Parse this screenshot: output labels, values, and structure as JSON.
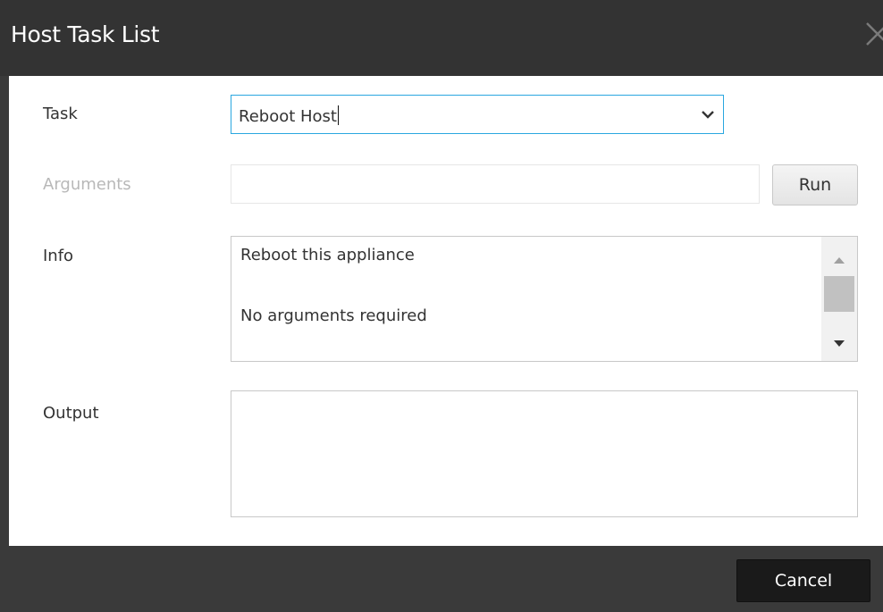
{
  "window": {
    "title": "Host Task List",
    "close_icon": "close-icon"
  },
  "form": {
    "task": {
      "label": "Task",
      "value": "Reboot Host",
      "icon": "chevron-down-icon"
    },
    "arguments": {
      "label": "Arguments",
      "value": "",
      "placeholder": "",
      "enabled": false
    },
    "run_label": "Run",
    "info": {
      "label": "Info",
      "lines": [
        "Reboot this appliance",
        "No arguments required"
      ]
    },
    "output": {
      "label": "Output",
      "value": ""
    }
  },
  "footer": {
    "cancel_label": "Cancel"
  },
  "colors": {
    "titlebar": "#333333",
    "focus_border": "#2aa7e0",
    "footer": "#3a3a3a",
    "cancel_button": "#1a1a1a",
    "disabled_label": "#b8b8b8"
  }
}
